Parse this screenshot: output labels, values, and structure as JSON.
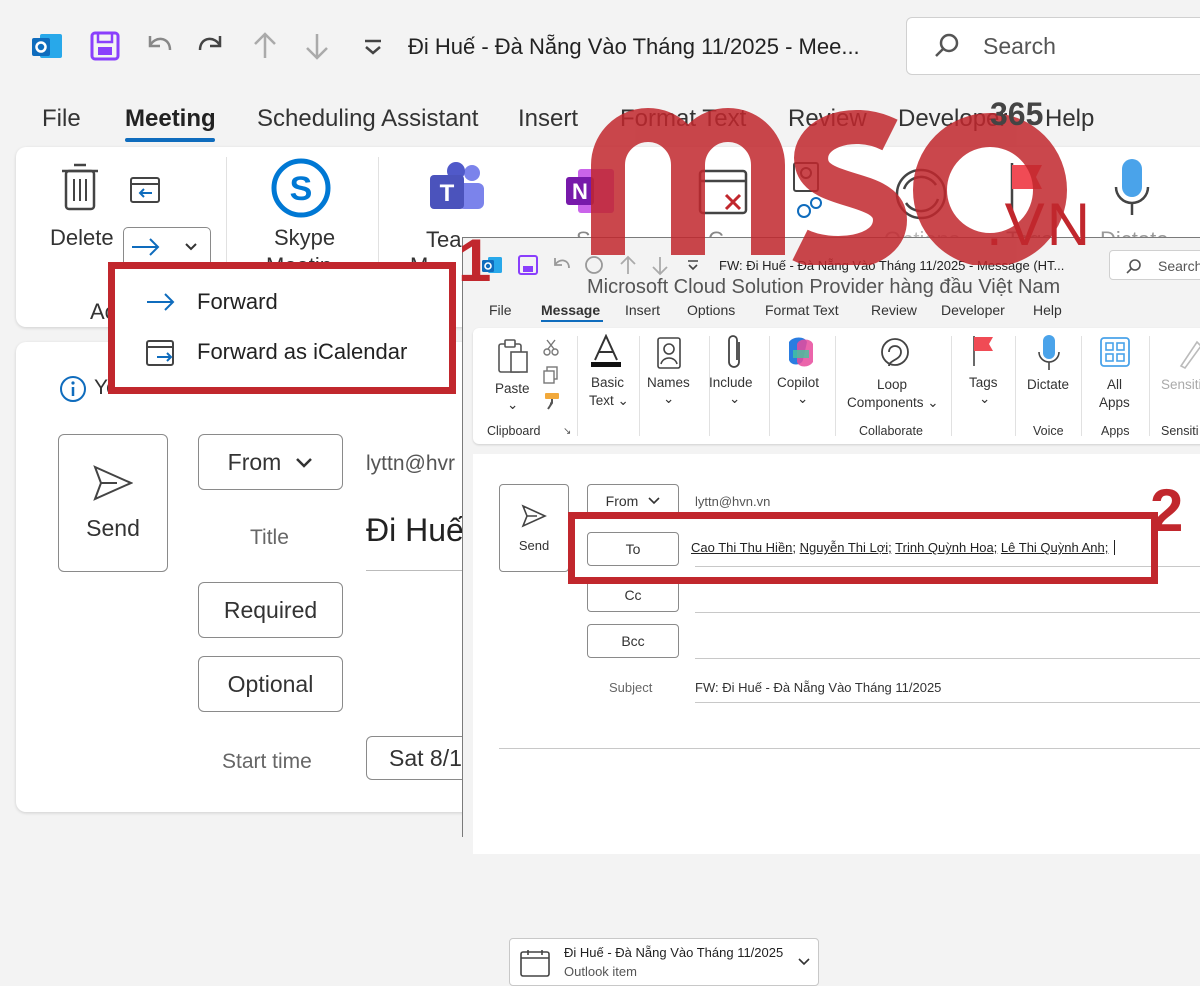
{
  "background_window": {
    "title": "Đi Huế - Đà Nẵng Vào Tháng 11/2025  -  Mee...",
    "search_placeholder": "Search",
    "menu": [
      "File",
      "Meeting",
      "Scheduling Assistant",
      "Insert",
      "Format Text",
      "Review",
      "Developer",
      "Help"
    ],
    "ribbon": {
      "delete_label": "Delete",
      "actions_group_partial": "Ac",
      "skype_label": "Skype",
      "skype_label2": "Meetin",
      "teams_label": "Tea",
      "teams_label2": "M",
      "onenote_partial": "S",
      "cancel_partial": "C",
      "options_label": "Options",
      "tags_label": "Tags",
      "dictate_label": "Dictate"
    },
    "info_partial": "Yo",
    "form": {
      "send_label": "Send",
      "from_label": "From",
      "from_value": "lyttn@hvr",
      "title_label": "Title",
      "title_value": "Đi Huế",
      "required_label": "Required",
      "optional_label": "Optional",
      "start_time_label": "Start time",
      "start_time_value": "Sat 8/1"
    }
  },
  "forward_menu": {
    "items": [
      "Forward",
      "Forward as iCalendar"
    ]
  },
  "watermark": {
    "brand": "mso",
    "brand_suffix": ".VN",
    "brand_number": "365",
    "tagline": "Microsoft Cloud Solution Provider hàng đầu Việt Nam"
  },
  "annotations": {
    "step1": "1",
    "step2": "2"
  },
  "message_window": {
    "title": "FW: Đi Huế - Đà Nẵng Vào Tháng 11/2025  -  Message (HT...",
    "search_placeholder": "Search",
    "menu": [
      "File",
      "Message",
      "Insert",
      "Options",
      "Format Text",
      "Review",
      "Developer",
      "Help"
    ],
    "ribbon": {
      "paste": "Paste",
      "basic_text": "Basic",
      "basic_text2": "Text",
      "names": "Names",
      "include": "Include",
      "copilot": "Copilot",
      "loop": "Loop",
      "loop2": "Components",
      "tags": "Tags",
      "dictate": "Dictate",
      "all_apps": "All",
      "all_apps2": "Apps",
      "sensitivity": "Sensiti",
      "groups": {
        "clipboard": "Clipboard",
        "collaborate": "Collaborate",
        "voice": "Voice",
        "apps": "Apps",
        "sensitivity": "Sensiti"
      }
    },
    "compose": {
      "send_label": "Send",
      "from_label": "From",
      "from_value": "lyttn@hvn.vn",
      "to_label": "To",
      "cc_label": "Cc",
      "bcc_label": "Bcc",
      "recipients": [
        "Cao Thi Thu Hiền;",
        "Nguyễn Thi Lợi;",
        "Trinh Quỳnh Hoa;",
        "Lê Thi Quỳnh Anh;"
      ],
      "subject_label": "Subject",
      "subject_value": "FW: Đi Huế - Đà Nẵng Vào Tháng 11/2025",
      "attachment_name": "Đi Huế - Đà Nẵng Vào Tháng 11/2025",
      "attachment_type": "Outlook item"
    }
  },
  "colors": {
    "accent": "#0f6cbd",
    "highlight": "#c1272d",
    "purple": "#8a3ffc"
  }
}
